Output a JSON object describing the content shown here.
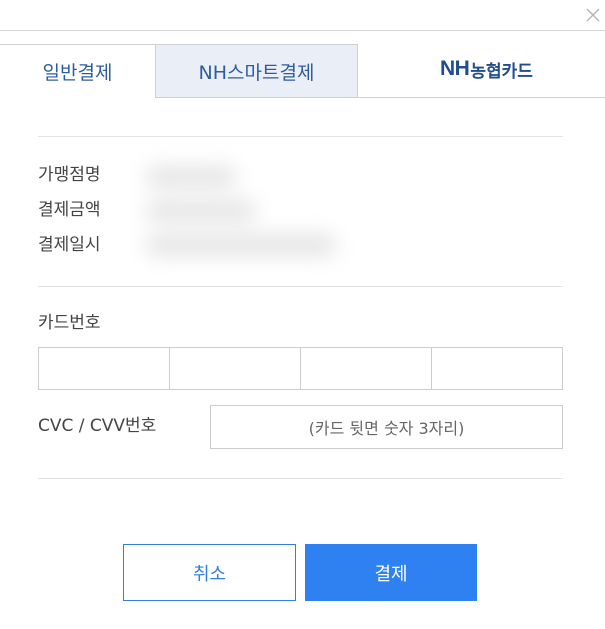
{
  "dialog": {
    "close_icon": "close-icon"
  },
  "tabs": [
    {
      "label": "일반결제",
      "active": true
    },
    {
      "label": "NH스마트결제",
      "active": false
    }
  ],
  "brand": {
    "prefix": "NH",
    "suffix": "농협카드",
    "color": "#1f4d8f"
  },
  "info": {
    "merchant_label": "가맹점명",
    "amount_label": "결제금액",
    "datetime_label": "결제일시"
  },
  "card": {
    "number_label": "카드번호",
    "number_segments": [
      "",
      "",
      "",
      ""
    ],
    "cvc_label": "CVC / CVV번호",
    "cvc_placeholder": "(카드 뒷면 숫자 3자리)"
  },
  "buttons": {
    "cancel_label": "취소",
    "pay_label": "결제"
  },
  "colors": {
    "accent": "#2f80f0",
    "tab_text": "#2e5d9f",
    "inactive_tab_bg": "#eaeff7"
  }
}
